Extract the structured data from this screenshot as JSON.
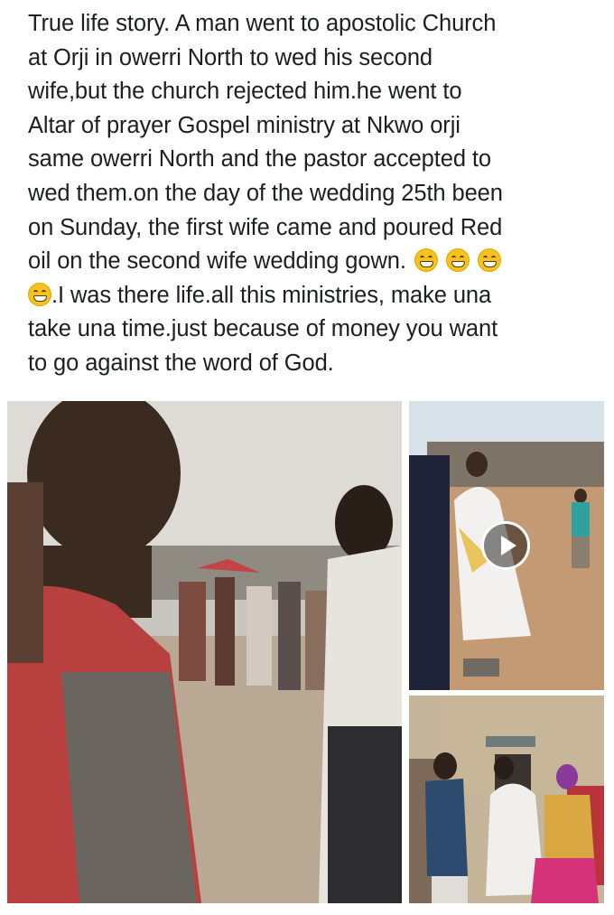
{
  "post": {
    "lines": [
      "True life story. A man went to apostolic Church",
      "at Orji in owerri North to wed his second",
      "wife,but the church rejected him.he went to",
      "Altar of prayer Gospel ministry at Nkwo orji",
      "same owerri North and the pastor accepted to",
      "wed them.on the day of the wedding 25th been",
      "on Sunday, the first wife came and poured Red",
      "oil on the second wife wedding gown.",
      ".I was there life.all this ministries, make una",
      "take una time.just because of money you want",
      "to go against the word of God."
    ],
    "emoji_name": "grinning-face-with-smiling-eyes"
  },
  "media": {
    "photos": [
      {
        "name": "boy-and-crowd-photo",
        "is_video": false
      },
      {
        "name": "bride-in-white-gown-video",
        "is_video": true
      },
      {
        "name": "bride-carried-to-building-photo",
        "is_video": false
      }
    ]
  }
}
